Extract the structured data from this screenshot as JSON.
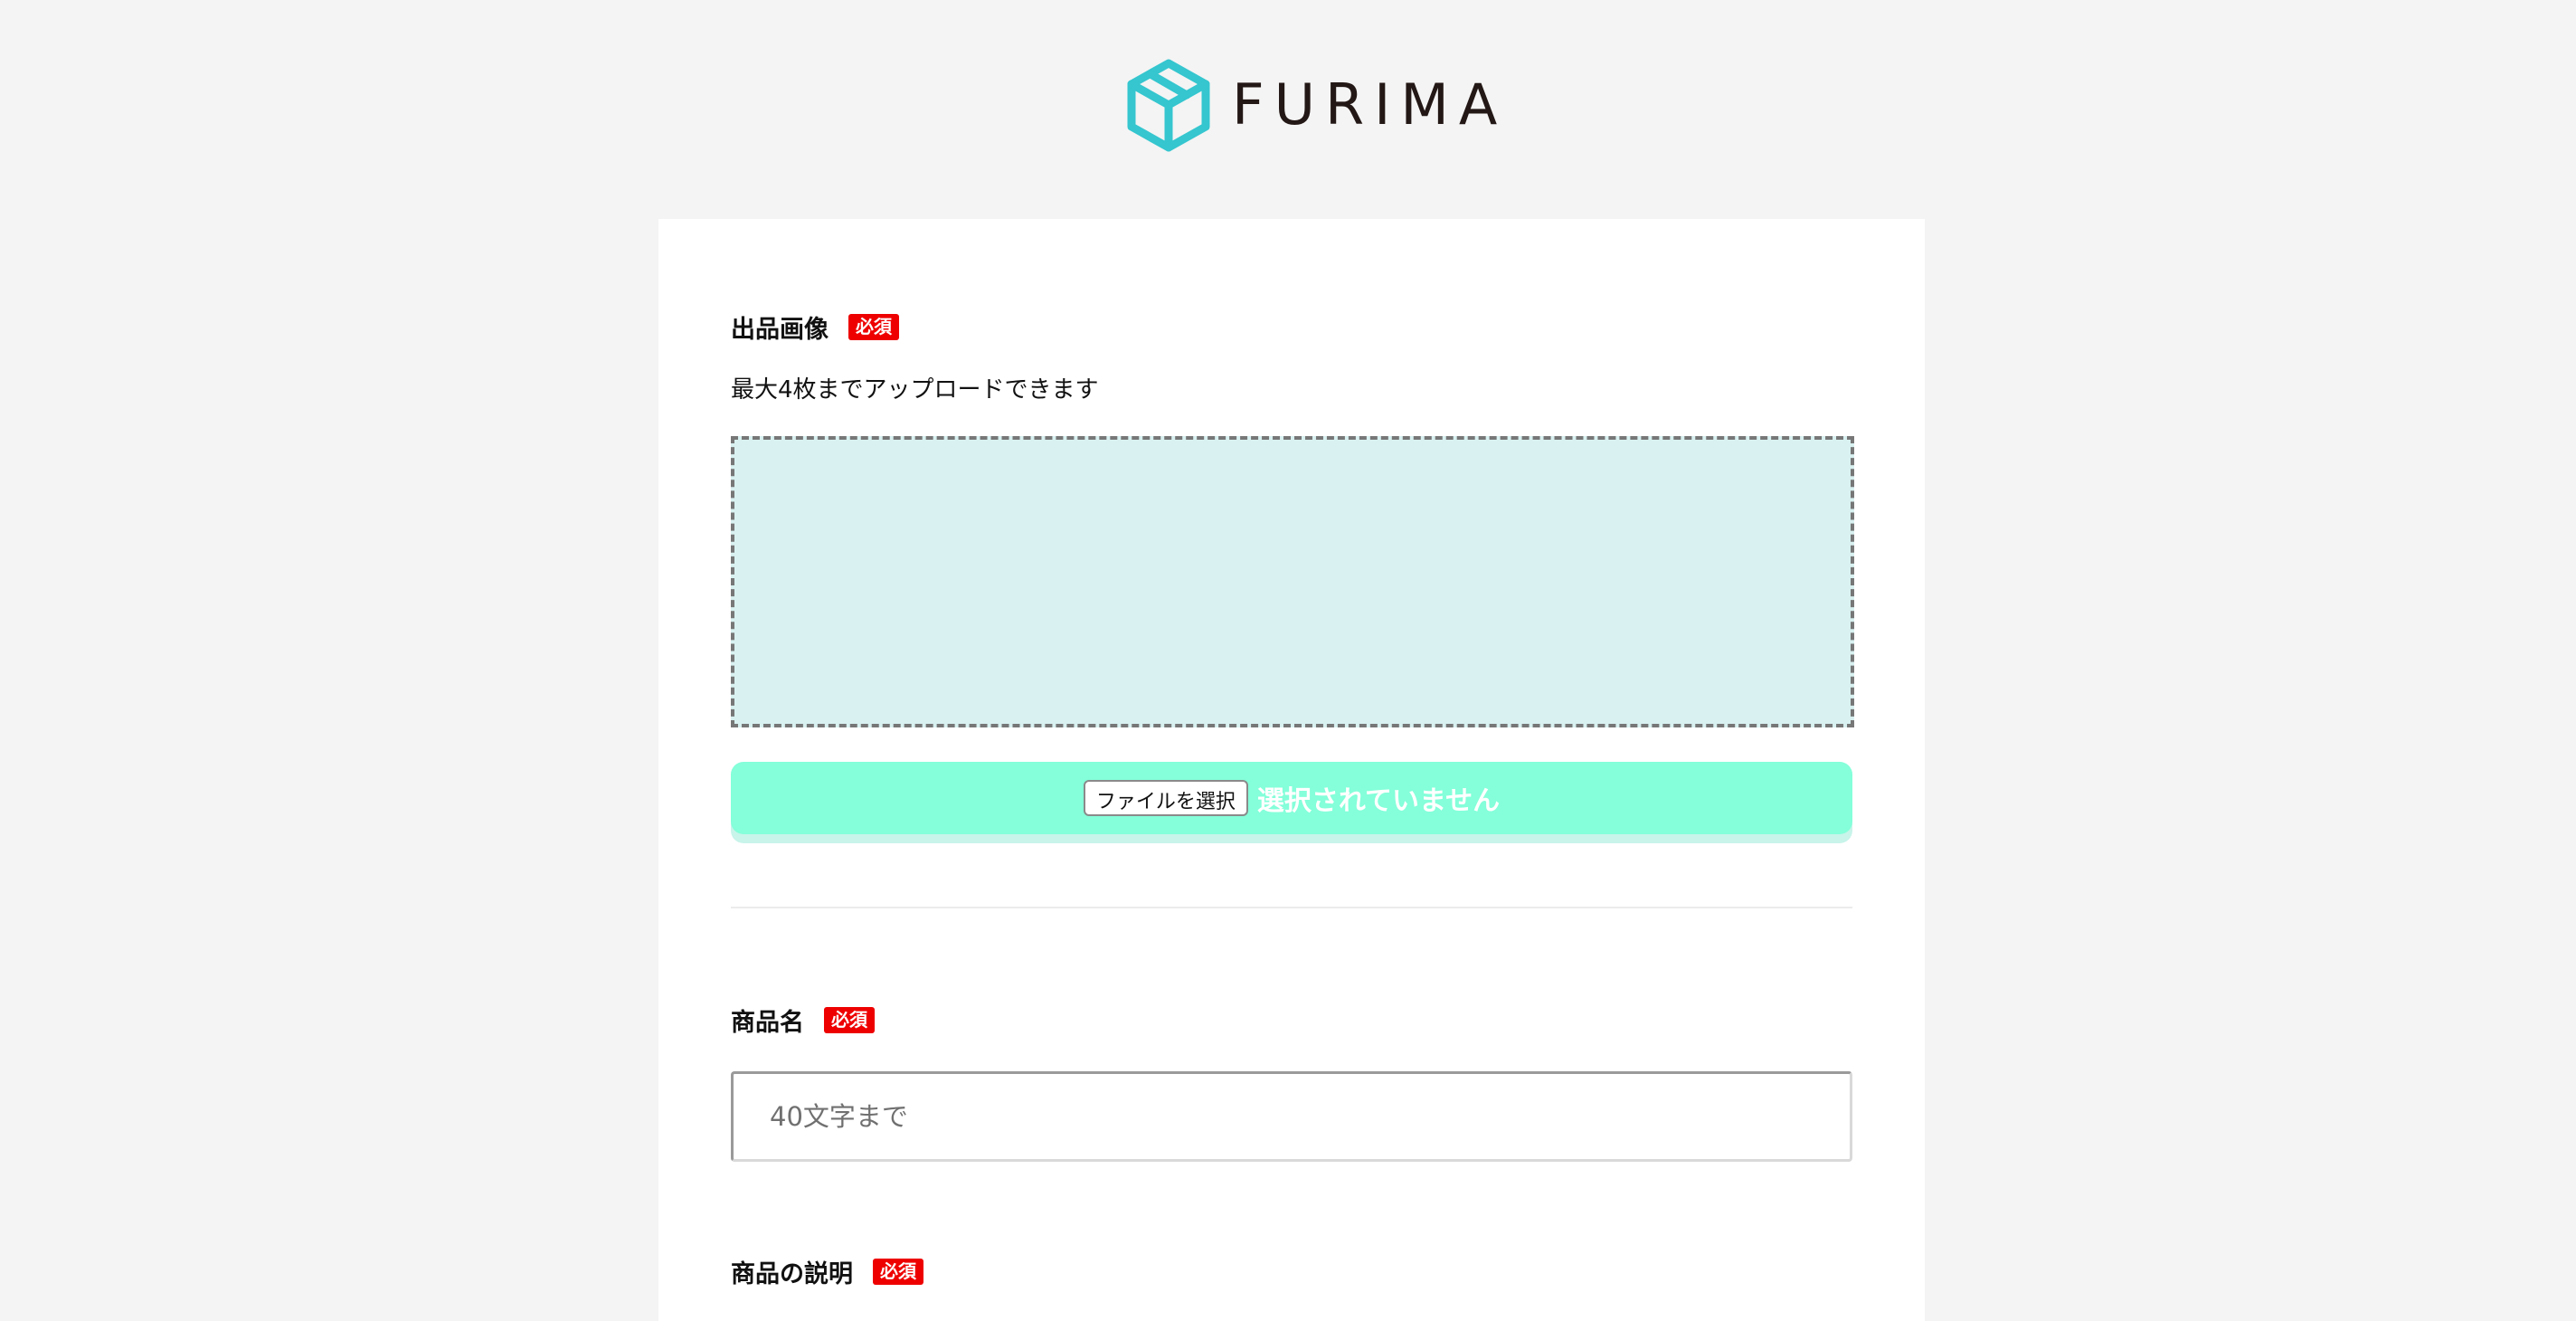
{
  "header": {
    "logo_text": "FURIMA",
    "logo_icon": "cube-icon",
    "logo_color": "#35c6cf"
  },
  "form": {
    "image_section": {
      "label": "出品画像",
      "required_badge": "必須",
      "note": "最大4枚までアップロードできます",
      "file_button": "ファイルを選択",
      "file_status": "選択されていません"
    },
    "product_name": {
      "label": "商品名",
      "required_badge": "必須",
      "placeholder": "40文字まで",
      "value": ""
    },
    "description": {
      "label": "商品の説明",
      "required_badge": "必須"
    }
  },
  "colors": {
    "background": "#f4f4f4",
    "panel": "#ffffff",
    "required_badge": "#ee0000",
    "drop_area": "#d9f1f1",
    "file_bar": "#84ffd9"
  }
}
